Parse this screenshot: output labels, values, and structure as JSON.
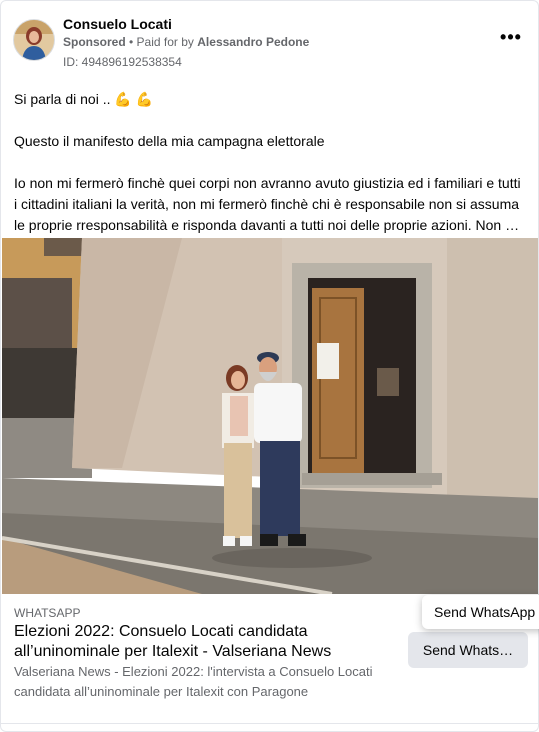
{
  "post": {
    "page_name": "Consuelo Locati",
    "sponsored_label": "Sponsored",
    "paid_for_prefix": "• Paid for by",
    "paid_for_name": "Alessandro Pedone",
    "ad_id": "ID: 494896192538354",
    "more_label": "•••",
    "text_lines": [
      "Si parla di noi .. 💪 💪",
      "Questo il manifesto della mia campagna elettorale",
      "Io non mi fermerò finchè quei corpi non avranno avuto giustizia ed i familiari e tutti",
      "i cittadini italiani la verità, non mi fermerò finchè chi è responsabile non si assuma",
      "le proprie rresponsabilità e risponda davanti a tutti noi delle proprie azioni. Non mi fermerò finchè..."
    ]
  },
  "link": {
    "domain": "WHATSAPP",
    "title": "Elezioni 2022: Consuelo Locati candidata all’uninominale per Italexit - Valseriana News",
    "description": "Valseriana News - Elezioni 2022: l'intervista a Consuelo Locati candidata all’uninominale per Italexit con Paragone",
    "cta_label": "Send Whats…",
    "tooltip": "Send WhatsApp message"
  },
  "colors": {
    "text_primary": "#050505",
    "text_secondary": "#65676b",
    "button_bg": "#e4e6eb",
    "border": "#e4e6eb"
  }
}
